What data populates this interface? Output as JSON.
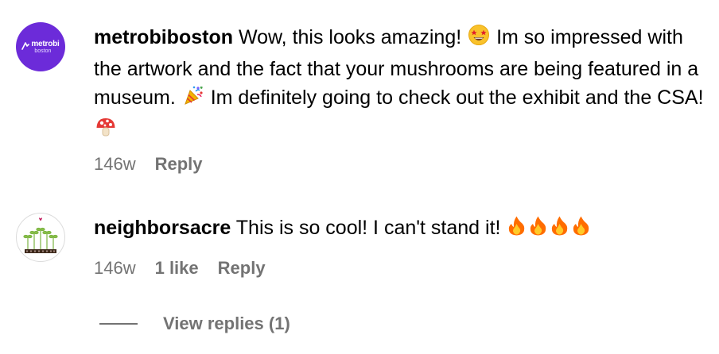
{
  "comments": [
    {
      "avatar": {
        "logo_word": "metrobi",
        "logo_sub": "boston",
        "color": "#6c2bd9"
      },
      "username": "metrobiboston",
      "text_parts": [
        "Wow, this looks amazing! ",
        " Im so impressed with the artwork and the fact that your mushrooms are being featured in a museum. ",
        " Im definitely going to check out the exhibit and the CSA! "
      ],
      "emojis": [
        "star-struck-emoji",
        "party-popper-emoji",
        "mushroom-emoji"
      ],
      "time": "146w",
      "reply_label": "Reply"
    },
    {
      "username": "neighborsacre",
      "text": "This is so cool! I can't stand it! ",
      "emojis": [
        "fire-emoji",
        "fire-emoji",
        "fire-emoji",
        "fire-emoji"
      ],
      "time": "146w",
      "likes_label": "1 like",
      "reply_label": "Reply"
    }
  ],
  "view_replies_label": "View replies (1)",
  "colors": {
    "meta_text": "#737373",
    "brand_purple": "#6c2bd9"
  }
}
